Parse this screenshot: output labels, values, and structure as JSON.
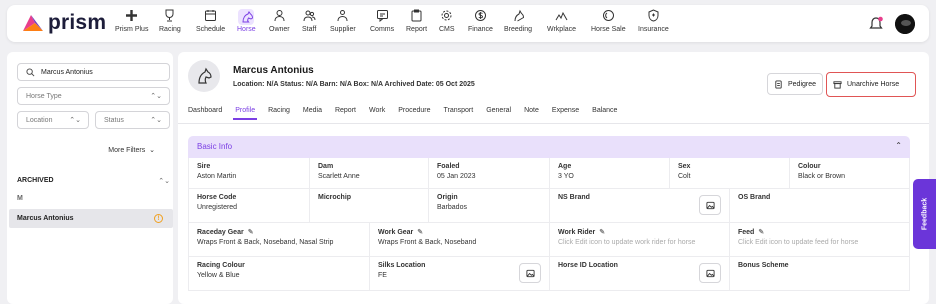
{
  "app": {
    "name": "prism",
    "accent": "#7b3fe4"
  },
  "nav": {
    "items": [
      {
        "label": "Prism Plus",
        "icon": "plus-icon"
      },
      {
        "label": "Racing",
        "icon": "trophy-icon"
      },
      {
        "label": "Schedule",
        "icon": "calendar-icon"
      },
      {
        "label": "Horse",
        "icon": "horse-icon",
        "active": true
      },
      {
        "label": "Owner",
        "icon": "person-icon"
      },
      {
        "label": "Staff",
        "icon": "people-icon"
      },
      {
        "label": "Supplier",
        "icon": "supplier-icon"
      },
      {
        "label": "Comms",
        "icon": "chat-icon"
      },
      {
        "label": "Report",
        "icon": "clipboard-icon"
      },
      {
        "label": "CMS",
        "icon": "gear-icon"
      },
      {
        "label": "Finance",
        "icon": "dollar-icon"
      },
      {
        "label": "Breeding",
        "icon": "breeding-icon"
      },
      {
        "label": "Wrkplace",
        "icon": "workplace-icon"
      },
      {
        "label": "Horse Sale",
        "icon": "tag-icon"
      },
      {
        "label": "Insurance",
        "icon": "shield-icon"
      }
    ]
  },
  "sidebar": {
    "search_value": "Marcus Antonius",
    "horse_type_placeholder": "Horse Type",
    "location_placeholder": "Location",
    "status_placeholder": "Status",
    "more_filters": "More Filters",
    "group_label": "ARCHIVED",
    "letter": "M",
    "selected_item": "Marcus Antonius"
  },
  "horse": {
    "name": "Marcus Antonius",
    "meta": "Location: N/A   Status: N/A   Barn: N/A   Box: N/A   Archived Date: 05 Oct 2025"
  },
  "actions": {
    "pedigree": "Pedigree",
    "unarchive": "Unarchive Horse"
  },
  "tabs": [
    "Dashboard",
    "Profile",
    "Racing",
    "Media",
    "Report",
    "Work",
    "Procedure",
    "Transport",
    "General",
    "Note",
    "Expense",
    "Balance"
  ],
  "active_tab": "Profile",
  "basic_info": {
    "title": "Basic Info",
    "row1": [
      {
        "label": "Sire",
        "value": "Aston Martin"
      },
      {
        "label": "Dam",
        "value": "Scarlett Anne"
      },
      {
        "label": "Foaled",
        "value": "05 Jan 2023"
      },
      {
        "label": "Age",
        "value": "3 YO"
      },
      {
        "label": "Sex",
        "value": "Colt"
      },
      {
        "label": "Colour",
        "value": "Black or Brown"
      }
    ],
    "row2": [
      {
        "label": "Horse Code",
        "value": "Unregistered"
      },
      {
        "label": "Microchip",
        "value": ""
      },
      {
        "label": "Origin",
        "value": "Barbados"
      },
      {
        "label": "NS Brand",
        "value": ""
      },
      {
        "label": "OS Brand",
        "value": ""
      }
    ],
    "row3": [
      {
        "label": "Raceday Gear",
        "value": "Wraps Front & Back, Noseband, Nasal Strip"
      },
      {
        "label": "Work Gear",
        "value": "Wraps Front & Back, Noseband"
      },
      {
        "label": "Work Rider",
        "value": "Click Edit icon to update work rider for horse"
      },
      {
        "label": "Feed",
        "value": "Click Edit icon to update feed for horse"
      }
    ],
    "row4": [
      {
        "label": "Racing Colour",
        "value": "Yellow & Blue"
      },
      {
        "label": "Silks Location",
        "value": "FE"
      },
      {
        "label": "Horse ID Location",
        "value": ""
      },
      {
        "label": "Bonus Scheme",
        "value": ""
      }
    ]
  },
  "feedback": "Feedback"
}
